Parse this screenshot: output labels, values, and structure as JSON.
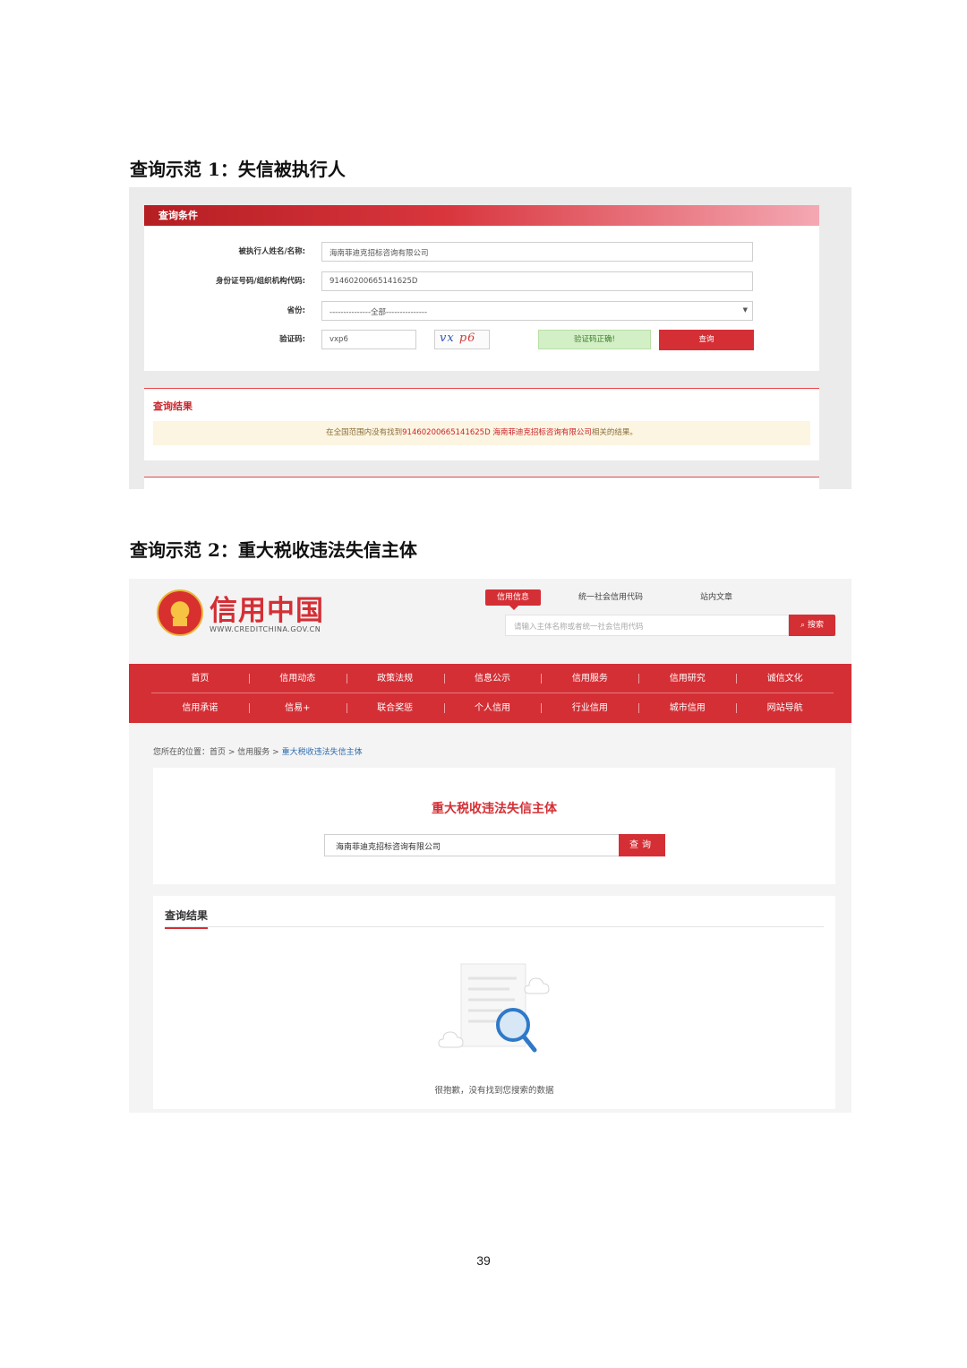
{
  "headings": {
    "demo1": "查询示范 1：失信被执行人",
    "demo2": "查询示范 2：重大税收违法失信主体"
  },
  "demo1": {
    "panel_title": "查询条件",
    "fields": [
      {
        "label": "被执行人姓名/名称:",
        "value": "海南菲迪克招标咨询有限公司"
      },
      {
        "label": "身份证号码/组织机构代码:",
        "value": "91460200665141625D"
      },
      {
        "label": "省份:",
        "value": "---------------全部---------------"
      }
    ],
    "captcha_label": "验证码:",
    "captcha_value": "vxp6",
    "captcha_image_a": "vx",
    "captcha_image_b": "p6",
    "captcha_ok": "验证码正确!",
    "query_button": "查询",
    "result_title": "查询结果",
    "notice_prefix": "在全国范围内没有找到",
    "notice_code": "91460200665141625D",
    "notice_name": "海南菲迪克招标咨询有限公司",
    "notice_suffix": "相关的结果。"
  },
  "demo2": {
    "logo_text": "信用中国",
    "logo_url": "WWW.CREDITCHINA.GOV.CN",
    "tabs": [
      "信用信息",
      "统一社会信用代码",
      "站内文章"
    ],
    "search_placeholder": "请输入主体名称或者统一社会信用代码",
    "search_button": "搜索",
    "nav_row1": [
      "首页",
      "信用动态",
      "政策法规",
      "信息公示",
      "信用服务",
      "信用研究",
      "诚信文化"
    ],
    "nav_row2": [
      "信用承诺",
      "信易+",
      "联合奖惩",
      "个人信用",
      "行业信用",
      "城市信用",
      "网站导航"
    ],
    "breadcrumb": {
      "prefix": "您所在的位置：",
      "home": "首页",
      "sep": " > ",
      "service": "信用服务",
      "current": "重大税收违法失信主体"
    },
    "panel_title": "重大税收违法失信主体",
    "query_value": "海南菲迪克招标咨询有限公司",
    "query_button": "查询",
    "result_title": "查询结果",
    "empty_message": "很抱歉，没有找到您搜索的数据"
  },
  "page_number": "39",
  "colors": {
    "brand_red": "#d42f35",
    "notice_bg": "#fcf5e1",
    "ok_green": "#d3efc6"
  }
}
